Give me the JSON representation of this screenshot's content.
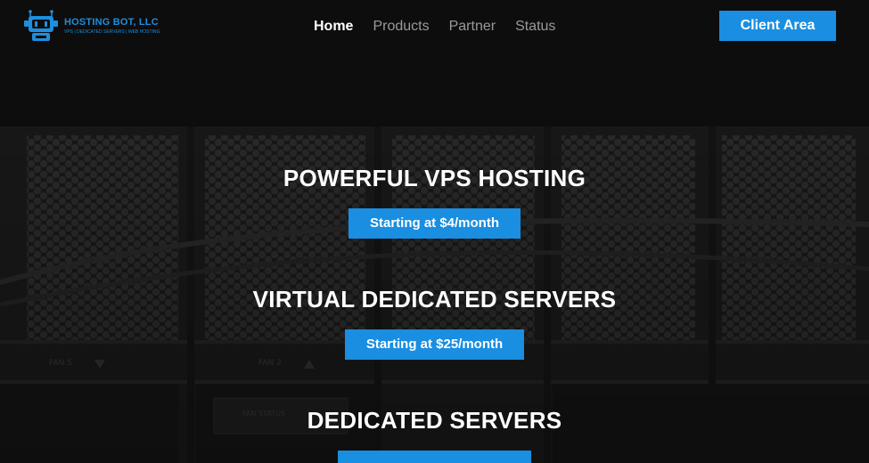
{
  "header": {
    "logo": {
      "name": "HOSTING BOT, LLC",
      "tagline": "VPS | DEDICATED SERVERS | WEB HOSTING"
    },
    "nav": [
      {
        "label": "Home",
        "active": true
      },
      {
        "label": "Products",
        "active": false
      },
      {
        "label": "Partner",
        "active": false
      },
      {
        "label": "Status",
        "active": false
      }
    ],
    "client_area_label": "Client Area"
  },
  "hero": {
    "background_labels": [
      "FAN 5",
      "FAN 2",
      "FAN STATUS"
    ],
    "offers": [
      {
        "title": "POWERFUL VPS HOSTING",
        "cta": "Starting at $4/month"
      },
      {
        "title": "VIRTUAL DEDICATED SERVERS",
        "cta": "Starting at $25/month"
      },
      {
        "title": "DEDICATED SERVERS",
        "cta": ""
      }
    ]
  },
  "colors": {
    "accent": "#1a8ee0",
    "header_bg": "#0d0d0d",
    "hero_bg": "#1c1c1c",
    "text": "#ffffff",
    "nav_inactive": "#9a9a9a"
  }
}
